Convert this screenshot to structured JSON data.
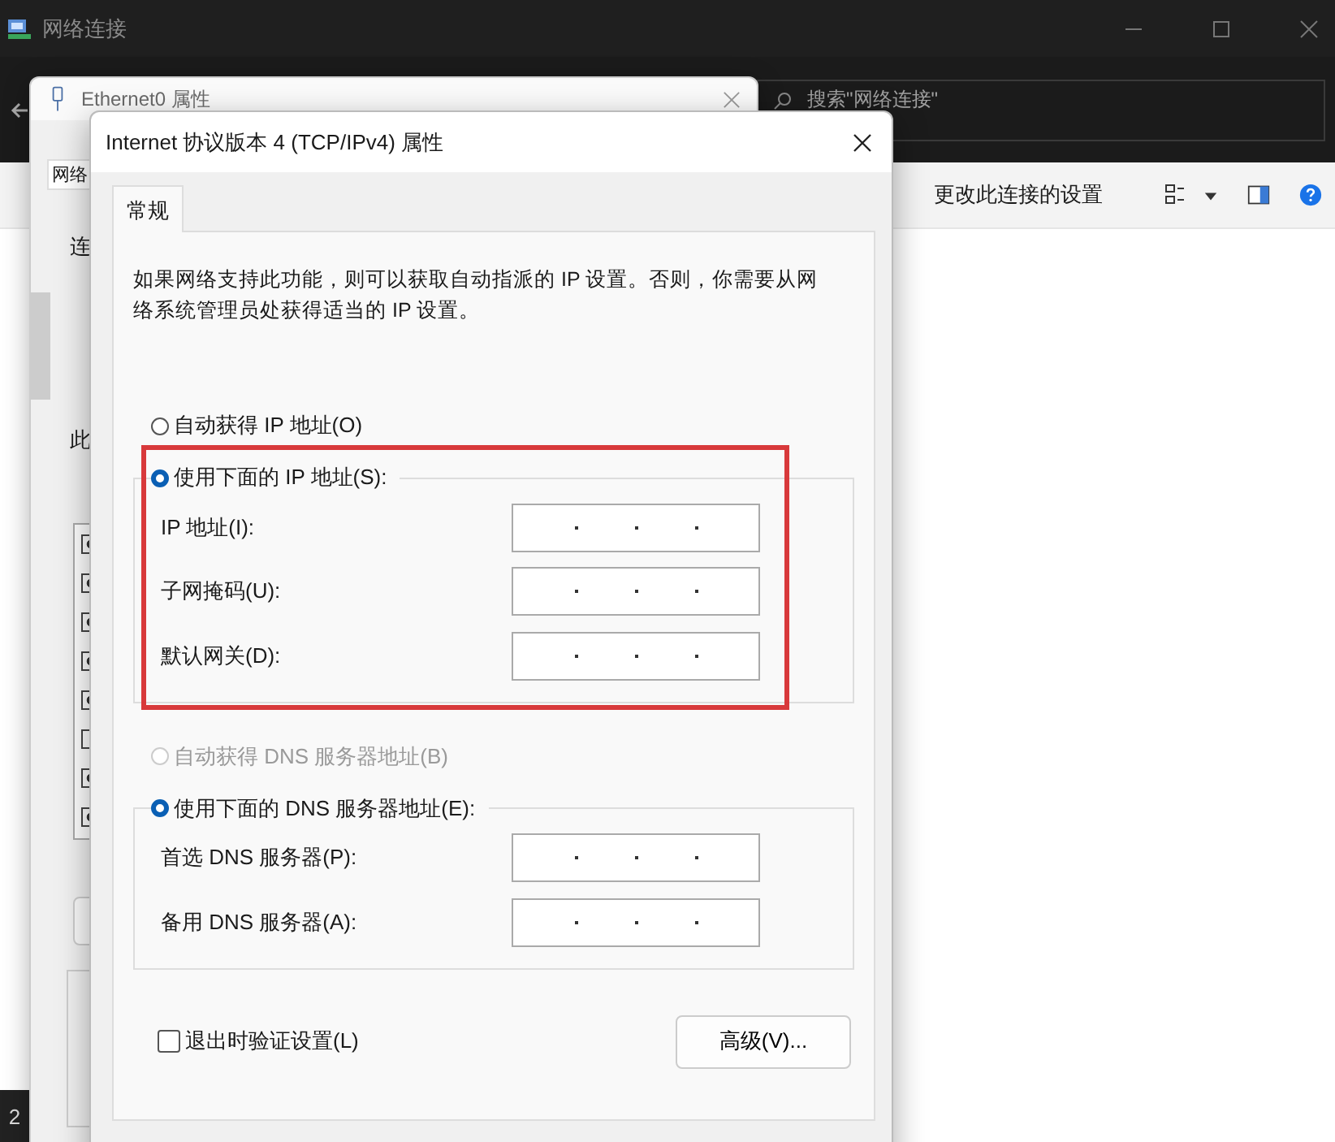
{
  "main_window": {
    "title": "网络连接",
    "search": {
      "placeholder": "搜索\"网络连接\""
    },
    "toolbar": {
      "action": "更改此连接的设置"
    },
    "status_bar": {
      "text": "2"
    }
  },
  "ethernet_dialog": {
    "title": "Ethernet0 属性",
    "tab": {
      "label": "网络",
      "selected": true
    },
    "labels": [
      "连",
      "此"
    ],
    "components": [
      {
        "checked": true
      },
      {
        "checked": true
      },
      {
        "checked": true
      },
      {
        "checked": true
      },
      {
        "checked": true
      },
      {
        "checked": false
      },
      {
        "checked": true
      },
      {
        "checked": true
      }
    ]
  },
  "ipv4_dialog": {
    "title": "Internet 协议版本 4 (TCP/IPv4) 属性",
    "tabs": [
      {
        "label": "常规",
        "selected": true
      }
    ],
    "description": "如果网络支持此功能，则可以获取自动指派的 IP 设置。否则，你需要从网络系统管理员处获得适当的 IP 设置。",
    "ip_group": {
      "options": [
        {
          "label": "自动获得 IP 地址(O)",
          "selected": false,
          "disabled": false
        },
        {
          "label": "使用下面的 IP 地址(S):",
          "selected": true,
          "disabled": false
        }
      ],
      "fields": [
        {
          "label": "IP 地址(I):"
        },
        {
          "label": "子网掩码(U):"
        },
        {
          "label": "默认网关(D):"
        }
      ]
    },
    "dns_group": {
      "options": [
        {
          "label": "自动获得 DNS 服务器地址(B)",
          "selected": false,
          "disabled": true
        },
        {
          "label": "使用下面的 DNS 服务器地址(E):",
          "selected": true,
          "disabled": false
        }
      ],
      "fields": [
        {
          "label": "首选 DNS 服务器(P):"
        },
        {
          "label": "备用 DNS 服务器(A):"
        }
      ]
    },
    "validate": {
      "label": "退出时验证设置(L)",
      "checked": false
    },
    "advanced_button": "高级(V)..."
  }
}
